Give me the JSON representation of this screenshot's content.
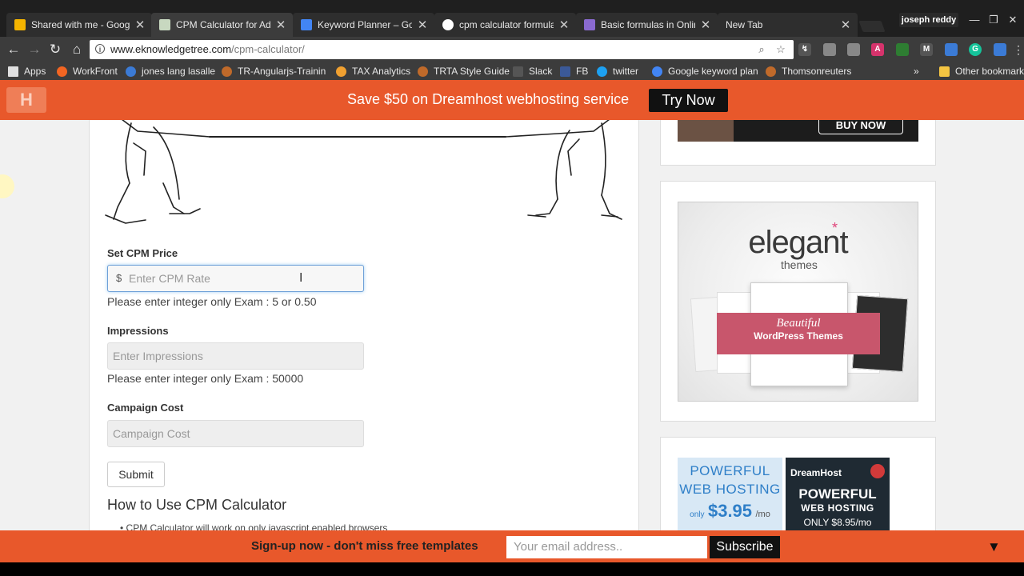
{
  "browser": {
    "tabs": [
      {
        "title": "Shared with me - Goog",
        "favicon_color": "#f4b400"
      },
      {
        "title": "CPM Calculator for Adv",
        "favicon_color": "#c8d8c0"
      },
      {
        "title": "Keyword Planner – Goo",
        "favicon_color": "#4285f4"
      },
      {
        "title": "cpm calculator formula",
        "favicon_color": "#ffffff"
      },
      {
        "title": "Basic formulas in Online",
        "favicon_color": "#8a6ad0"
      },
      {
        "title": "New Tab",
        "favicon_color": ""
      }
    ],
    "profile_name": "joseph reddy",
    "url_host": "www.eknowledgetree.com",
    "url_path": "/cpm-calculator/",
    "bookmarks": [
      {
        "label": "Apps",
        "color": "#e0e0e0"
      },
      {
        "label": "WorkFront",
        "color": "#f26522"
      },
      {
        "label": "jones lang lasalle",
        "color": "#3b7bd6"
      },
      {
        "label": "TR-Angularjs-Trainin",
        "color": "#c06a2a"
      },
      {
        "label": "TAX Analytics",
        "color": "#f0a030"
      },
      {
        "label": "TRTA Style Guide",
        "color": "#c06a2a"
      },
      {
        "label": "Slack",
        "color": "#555555"
      },
      {
        "label": "FB",
        "color": "#3b5998"
      },
      {
        "label": "twitter",
        "color": "#1da1f2"
      },
      {
        "label": "Google keyword plan",
        "color": "#4285f4"
      },
      {
        "label": "Thomsonreuters",
        "color": "#c06a2a"
      }
    ],
    "other_bookmarks": "Other bookmarks"
  },
  "promo": {
    "text": "Save $50 on Dreamhost webhosting service",
    "button": "Try Now",
    "logo_glyph": "H"
  },
  "form": {
    "cpm_label": "Set CPM Price",
    "currency": "$",
    "cpm_placeholder": "Enter CPM Rate",
    "cpm_help": "Please enter integer only Exam : 5 or 0.50",
    "impressions_label": "Impressions",
    "impressions_placeholder": "Enter Impressions",
    "impressions_help": "Please enter integer only Exam : 50000",
    "cost_label": "Campaign Cost",
    "cost_placeholder": "Campaign Cost",
    "submit": "Submit",
    "howto_heading": "How to Use CPM Calculator",
    "howto_first_item": "CPM Calculator will work on only javascript enabled browsers"
  },
  "sidebar": {
    "ad1_button": "BUY NOW",
    "elegant_title": "elegant",
    "elegant_sub": "themes",
    "elegant_ribbon1": "Beautiful",
    "elegant_ribbon2": "WordPress Themes",
    "dh_left_line1": "POWERFUL",
    "dh_left_line2": "WEB HOSTING",
    "dh_left_only": "only",
    "dh_left_price": "$3.95",
    "dh_left_mo": "/mo",
    "dh_brand": "DreamHost",
    "dh_right_line1": "POWERFUL",
    "dh_right_line2": "WEB HOSTING",
    "dh_right_price": "ONLY $8.95/mo"
  },
  "signup": {
    "text": "Sign-up now - don't miss free templates",
    "email_placeholder": "Your email address..",
    "button": "Subscribe",
    "arrow": "▼"
  }
}
